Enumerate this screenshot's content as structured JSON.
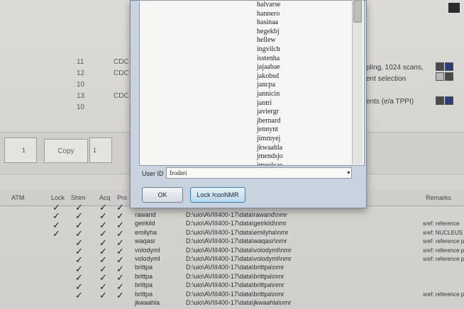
{
  "background": {
    "rows": [
      {
        "num": "11",
        "code": "CDC"
      },
      {
        "num": "12",
        "code": "CDC"
      },
      {
        "num": "10",
        "code": ""
      },
      {
        "num": "13",
        "code": "CDC"
      },
      {
        "num": "10",
        "code": ""
      }
    ],
    "right_texts": [
      "pling, 1024 scans,",
      "ent selection",
      "ents (e/a TPPI)"
    ],
    "copy_label": "Copy",
    "spin_value_left": "1",
    "spin_value_right": "1"
  },
  "table": {
    "headers": {
      "atm": "ATM",
      "lock": "Lock",
      "shim": "Shim",
      "acq": "Acq",
      "proc": "Pro",
      "remarks": "Remarks"
    },
    "rows": [
      {
        "user": "rawand",
        "path": "D:\\uio\\AVIII400-17\\data\\rawand\\nmr",
        "sref": ""
      },
      {
        "user": "geirkild",
        "path": "D:\\uio\\AVIII400-17\\data\\geirkild\\nmr",
        "sref": "sref: reference"
      },
      {
        "user": "emilyha",
        "path": "D:\\uio\\AVIII400-17\\data\\emilyha\\nmr",
        "sref": "sref: NUCLEUS"
      },
      {
        "user": "waqasr",
        "path": "D:\\uio\\AVIII400-17\\data\\waqasr\\nmr",
        "sref": "sref: reference p"
      },
      {
        "user": "volodyml",
        "path": "D:\\uio\\AVIII400-17\\data\\volodyml\\nmr",
        "sref": "sref: reference p"
      },
      {
        "user": "volodyml",
        "path": "D:\\uio\\AVIII400-17\\data\\volodyml\\nmr",
        "sref": "sref: reference p"
      },
      {
        "user": "brittpa",
        "path": "D:\\uio\\AVIII400-17\\data\\brittpa\\nmr",
        "sref": ""
      },
      {
        "user": "brittpa",
        "path": "D:\\uio\\AVIII400-17\\data\\brittpa\\nmr",
        "sref": ""
      },
      {
        "user": "brittpa",
        "path": "D:\\uio\\AVIII400-17\\data\\brittpa\\nmr",
        "sref": ""
      },
      {
        "user": "brittpa",
        "path": "D:\\uio\\AVIII400-17\\data\\brittpa\\nmr",
        "sref": "sref: reference p"
      },
      {
        "user": "jkwaahla",
        "path": "D:\\uio\\AVIII400-17\\data\\jkwaahla\\nmr",
        "sref": ""
      }
    ]
  },
  "dialog": {
    "users": [
      "halvarse",
      "hannero",
      "hasinaa",
      "hegekbj",
      "hellew",
      "ingvilch",
      "isstenha",
      "jajaabae",
      "jakobsd",
      "jancpa",
      "jannicin",
      "jantri",
      "javiergr",
      "jbernard",
      "jennynt",
      "jimmyej",
      "jkwaahla",
      "jmendsjo",
      "jmoolsae"
    ],
    "userid_label": "User ID",
    "userid_value": "froderi",
    "ok_label": "OK",
    "lock_label": "Lock IconNMR"
  },
  "colors": {
    "accent": "#3c7fb1",
    "dialog_bg": "#c8d3df"
  }
}
